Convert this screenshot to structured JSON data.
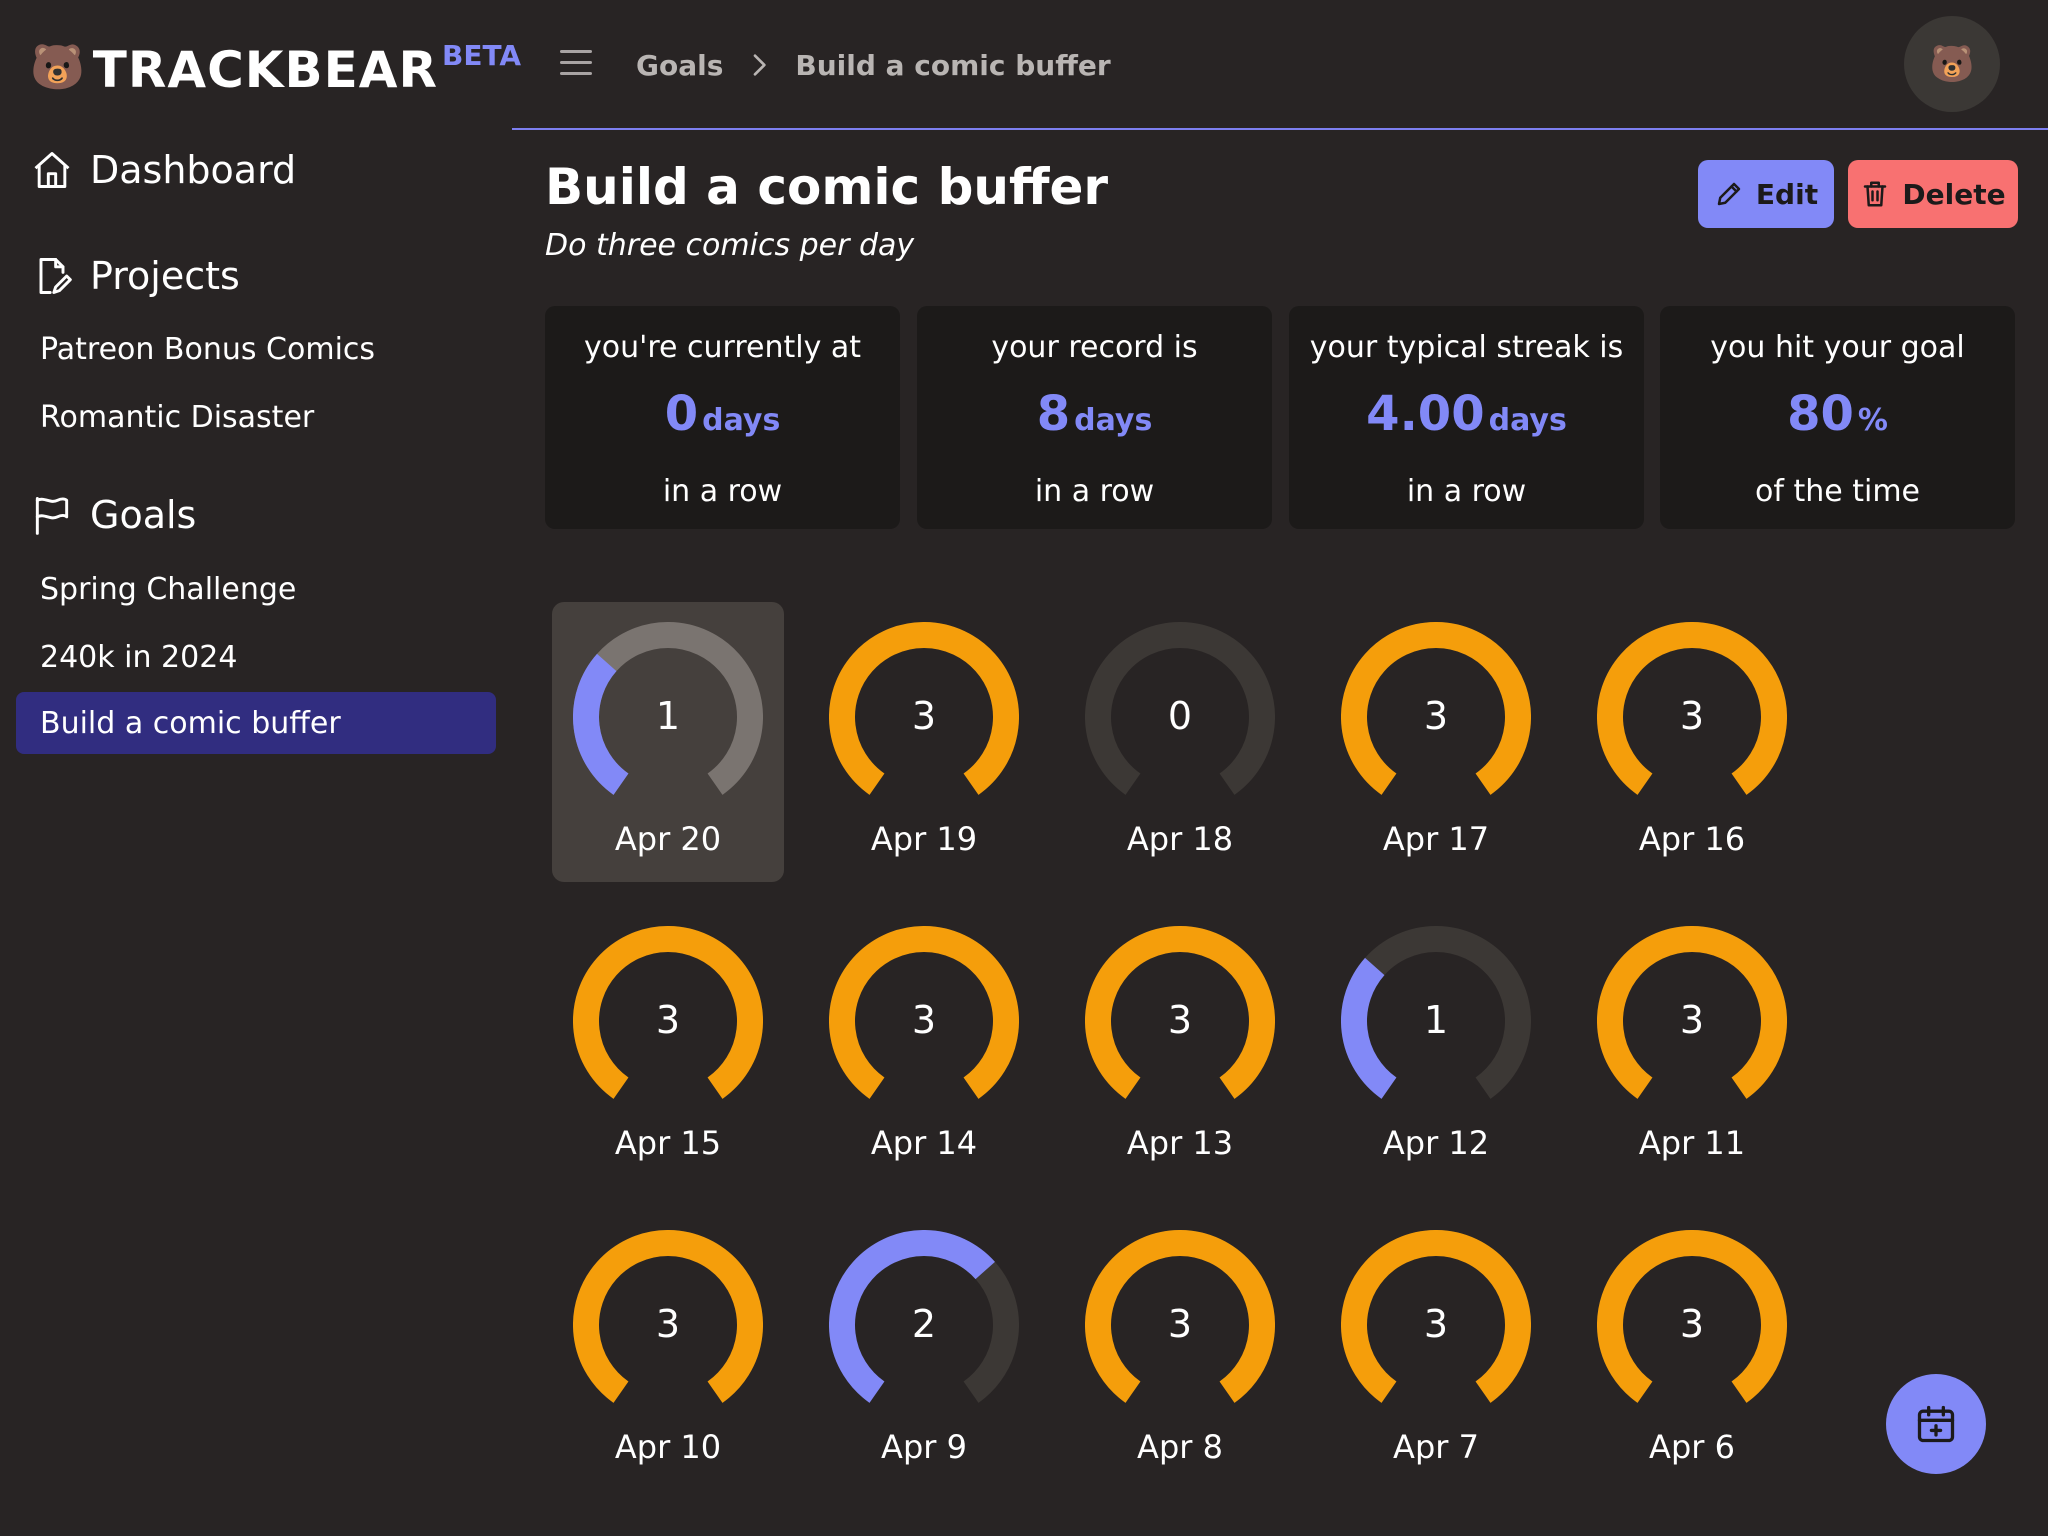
{
  "brand": {
    "name": "TRACKBEAR",
    "beta": "BETA",
    "logo_icon": "bear-face-icon"
  },
  "sidebar": {
    "dashboard_label": "Dashboard",
    "projects_label": "Projects",
    "projects": [
      "Patreon Bonus Comics",
      "Romantic Disaster"
    ],
    "goals_label": "Goals",
    "goals": [
      "Spring Challenge",
      "240k in 2024",
      "Build a comic buffer"
    ],
    "active_goal": "Build a comic buffer"
  },
  "header": {
    "breadcrumb": [
      "Goals",
      "Build a comic buffer"
    ]
  },
  "page": {
    "title": "Build a comic buffer",
    "subtitle": "Do three comics per day",
    "edit_label": "Edit",
    "delete_label": "Delete"
  },
  "stats": [
    {
      "top": "you're currently at",
      "value": "0",
      "unit": "days",
      "bottom": "in a row"
    },
    {
      "top": "your record is",
      "value": "8",
      "unit": "days",
      "bottom": "in a row"
    },
    {
      "top": "your typical streak is",
      "value": "4.00",
      "unit": "days",
      "bottom": "in a row"
    },
    {
      "top": "you hit your goal",
      "value": "80",
      "unit": "%",
      "bottom": "of the time"
    }
  ],
  "goal_per_day": 3,
  "days": [
    {
      "date": "Apr 20",
      "count": 1,
      "selected": true
    },
    {
      "date": "Apr 19",
      "count": 3
    },
    {
      "date": "Apr 18",
      "count": 0
    },
    {
      "date": "Apr 17",
      "count": 3
    },
    {
      "date": "Apr 16",
      "count": 3
    },
    {
      "date": "Apr 15",
      "count": 3
    },
    {
      "date": "Apr 14",
      "count": 3
    },
    {
      "date": "Apr 13",
      "count": 3
    },
    {
      "date": "Apr 12",
      "count": 1
    },
    {
      "date": "Apr 11",
      "count": 3
    },
    {
      "date": "Apr 10",
      "count": 3
    },
    {
      "date": "Apr 9",
      "count": 2
    },
    {
      "date": "Apr 8",
      "count": 3
    },
    {
      "date": "Apr 7",
      "count": 3
    },
    {
      "date": "Apr 6",
      "count": 3
    }
  ],
  "colors": {
    "accent": "#8289f7",
    "complete": "#f59e0b",
    "track": "#3c3835",
    "track_selected": "#7a7470",
    "danger": "#f87171"
  }
}
